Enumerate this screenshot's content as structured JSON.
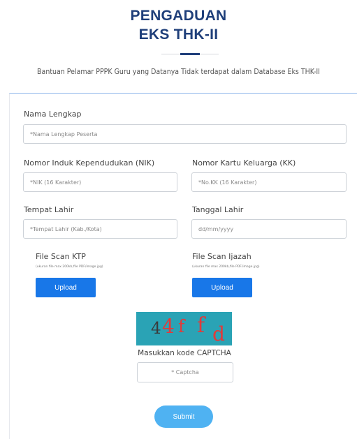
{
  "header": {
    "title_line1": "PENGADUAN",
    "title_line2": "EKS THK-II",
    "subtitle": "Bantuan Pelamar PPPK Guru yang Datanya Tidak terdapat dalam Database Eks THK-II"
  },
  "form": {
    "nama": {
      "label": "Nama Lengkap",
      "placeholder": "*Nama Lengkap Peserta",
      "value": ""
    },
    "nik": {
      "label": "Nomor Induk Kependudukan (NIK)",
      "placeholder": "*NIK (16 Karakter)",
      "value": ""
    },
    "kk": {
      "label": "Nomor Kartu Keluarga (KK)",
      "placeholder": "*No.KK (16 Karakter)",
      "value": ""
    },
    "tempat_lahir": {
      "label": "Tempat Lahir",
      "placeholder": "*Tempat Lahir (Kab./Kota)",
      "value": ""
    },
    "tanggal_lahir": {
      "label": "Tanggal Lahir",
      "placeholder": "dd/mm/yyyy",
      "value": ""
    },
    "ktp": {
      "label": "File Scan KTP",
      "hint": "(ukuran file max 200kb,file PDF/image jpg)",
      "button": "Upload"
    },
    "ijazah": {
      "label": "File Scan Ijazah",
      "hint": "(ukuran file max 200kb,file PDF/image jpg)",
      "button": "Upload"
    },
    "captcha": {
      "chars": [
        "4",
        "4",
        "f",
        "f",
        "d"
      ],
      "label": "Masukkan kode CAPTCHA",
      "placeholder": "* Captcha",
      "value": ""
    },
    "submit_label": "Submit"
  },
  "colors": {
    "title": "#1f3f7a",
    "upload_button": "#1877e8",
    "submit_button": "#4fb2f2",
    "captcha_background": "#2aa3b5"
  }
}
